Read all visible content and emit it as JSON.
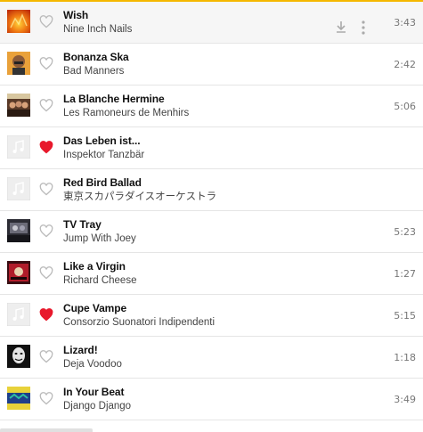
{
  "accent_color": "#f5b800",
  "liked_color": "#e8192c",
  "tracks": [
    {
      "title": "Wish",
      "artist": "Nine Inch Nails",
      "duration": "3:43",
      "liked": false,
      "art": "orange-fire"
    },
    {
      "title": "Bonanza Ska",
      "artist": "Bad Manners",
      "duration": "2:42",
      "liked": false,
      "art": "bald-man"
    },
    {
      "title": "La Blanche Hermine",
      "artist": "Les Ramoneurs de Menhirs",
      "duration": "5:06",
      "liked": false,
      "art": "band-photo"
    },
    {
      "title": "Das Leben ist...",
      "artist": "Inspektor Tanzbär",
      "duration": "",
      "liked": true,
      "art": "placeholder-note"
    },
    {
      "title": "Red Bird Ballad",
      "artist": "東京スカパラダイスオーケストラ",
      "duration": "",
      "liked": false,
      "art": "placeholder-note"
    },
    {
      "title": "TV Tray",
      "artist": "Jump With Joey",
      "duration": "5:23",
      "liked": false,
      "art": "dark-photo"
    },
    {
      "title": "Like a Virgin",
      "artist": "Richard Cheese",
      "duration": "1:27",
      "liked": false,
      "art": "red-dark"
    },
    {
      "title": "Cupe Vampe",
      "artist": "Consorzio Suonatori Indipendenti",
      "duration": "5:15",
      "liked": true,
      "art": "placeholder-note"
    },
    {
      "title": "Lizard!",
      "artist": "Deja Voodoo",
      "duration": "1:18",
      "liked": false,
      "art": "bw-face"
    },
    {
      "title": "In Your Beat",
      "artist": "Django Django",
      "duration": "3:49",
      "liked": false,
      "art": "blue-yellow"
    }
  ],
  "row_actions": {
    "download_icon": "download-icon",
    "more_icon": "more-vertical-icon"
  }
}
